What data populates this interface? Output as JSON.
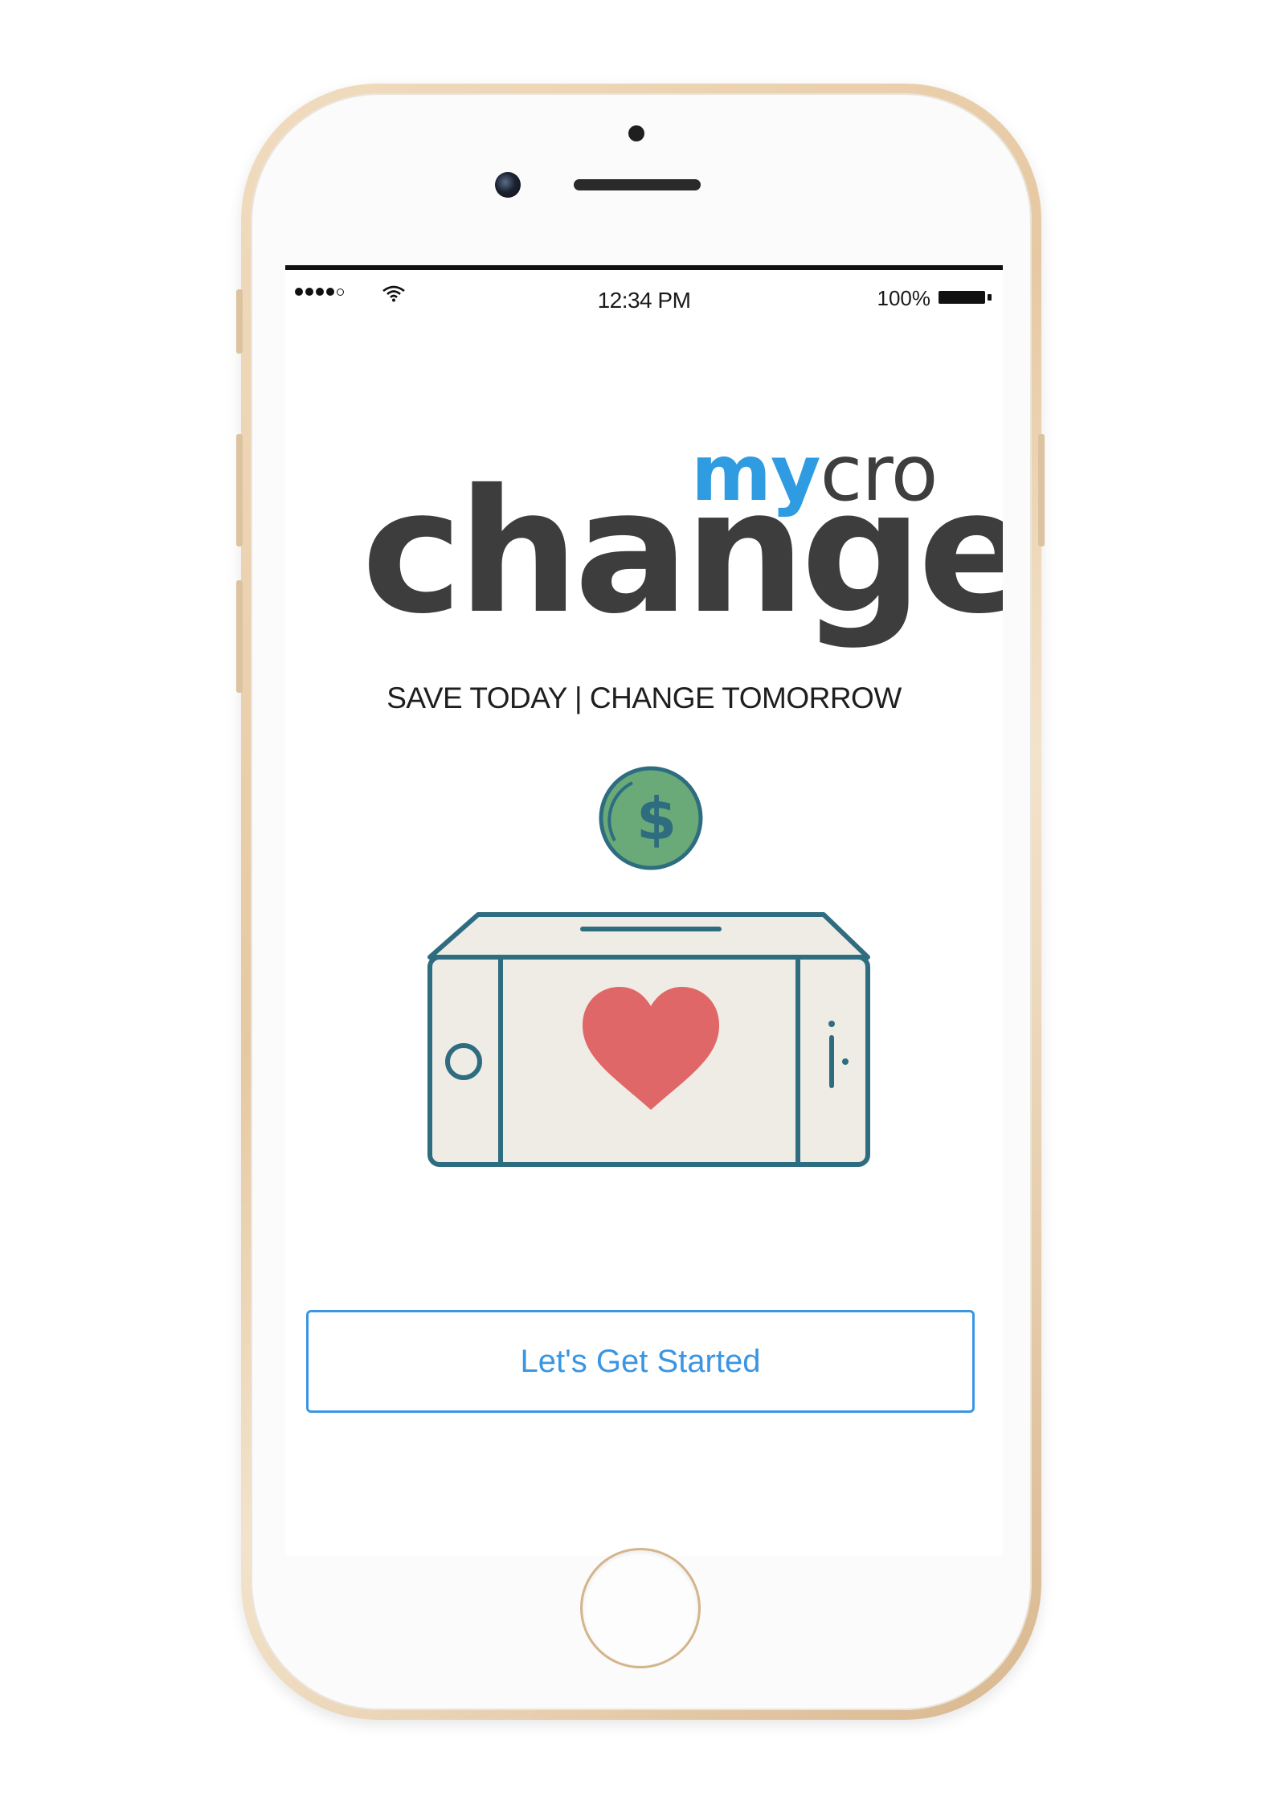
{
  "status_bar": {
    "time": "12:34 PM",
    "battery": "100%"
  },
  "logo": {
    "my": "my",
    "cro": "cro",
    "change": "change"
  },
  "tagline": "SAVE TODAY | CHANGE TOMORROW",
  "illustration": {
    "coin_symbol": "$",
    "icons": [
      "coin-icon",
      "phone-piggybank-icon",
      "heart-icon"
    ]
  },
  "cta": {
    "label": "Let's Get Started"
  },
  "colors": {
    "brand_blue": "#2f9be0",
    "logo_gray": "#3d3d3d",
    "coin_green": "#6aaa78",
    "outline_teal": "#2e6d80",
    "heart_red": "#e06767",
    "screen_fill": "#efebe5"
  }
}
